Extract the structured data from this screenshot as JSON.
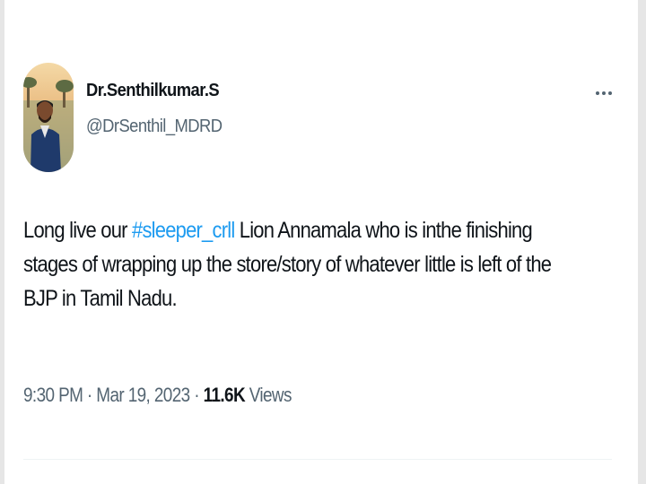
{
  "tweet": {
    "author": {
      "display_name": "Dr.Senthilkumar.S",
      "handle": "@DrSenthil_MDRD"
    },
    "more_icon": "more-horizontal-icon",
    "text": {
      "before_hashtag": "Long live our ",
      "hashtag": "#sleeper_crll",
      "after_hashtag": " Lion Annamala who is inthe finishing stages of wrapping up the store/story of whatever little is left of the BJP in Tamil Nadu."
    },
    "meta": {
      "time": "9:30 PM",
      "separator": "·",
      "date": "Mar 19, 2023",
      "views_count": "11.6K",
      "views_label": "Views"
    }
  },
  "colors": {
    "accent": "#1d9bf0",
    "text_primary": "#0f1419",
    "text_secondary": "#536471"
  }
}
